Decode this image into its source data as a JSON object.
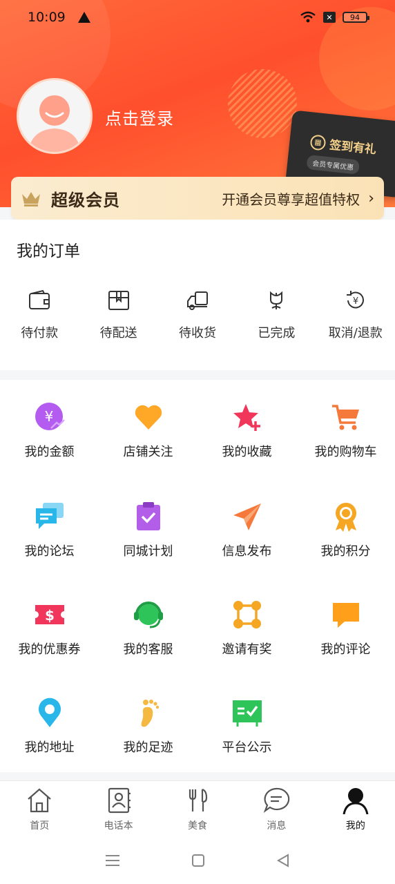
{
  "status": {
    "time": "10:09",
    "battery": "94"
  },
  "profile": {
    "login": "点击登录"
  },
  "sign_card": {
    "title": "签到有礼",
    "subtitle": "会员专属优惠"
  },
  "vip": {
    "title": "超级会员",
    "desc": "开通会员尊享超值特权"
  },
  "orders": {
    "title": "我的订单",
    "items": [
      {
        "label": "待付款",
        "icon": "wallet-icon"
      },
      {
        "label": "待配送",
        "icon": "package-icon"
      },
      {
        "label": "待收货",
        "icon": "truck-icon"
      },
      {
        "label": "已完成",
        "icon": "flower-icon"
      },
      {
        "label": "取消/退款",
        "icon": "refund-icon"
      }
    ]
  },
  "grid": {
    "items": [
      {
        "label": "我的金额",
        "icon": "yen-coin-icon",
        "color": "#b45cf0"
      },
      {
        "label": "店铺关注",
        "icon": "heart-icon",
        "color": "#ffa726"
      },
      {
        "label": "我的收藏",
        "icon": "star-add-icon",
        "color": "#f0365a"
      },
      {
        "label": "我的购物车",
        "icon": "cart-icon",
        "color": "#f4793b"
      },
      {
        "label": "我的论坛",
        "icon": "chat-bubbles-icon",
        "color": "#29b6e8"
      },
      {
        "label": "同城计划",
        "icon": "clipboard-check-icon",
        "color": "#b35ee8"
      },
      {
        "label": "信息发布",
        "icon": "paper-plane-icon",
        "color": "#f4793b"
      },
      {
        "label": "我的积分",
        "icon": "medal-icon",
        "color": "#f5a623"
      },
      {
        "label": "我的优惠券",
        "icon": "coupon-icon",
        "color": "#f0365a"
      },
      {
        "label": "我的客服",
        "icon": "headset-icon",
        "color": "#2ec45a"
      },
      {
        "label": "邀请有奖",
        "icon": "network-icon",
        "color": "#f5a623"
      },
      {
        "label": "我的评论",
        "icon": "comment-icon",
        "color": "#ff9f1a"
      },
      {
        "label": "我的地址",
        "icon": "location-pin-icon",
        "color": "#29b6e8"
      },
      {
        "label": "我的足迹",
        "icon": "footprint-icon",
        "color": "#f5b942"
      },
      {
        "label": "平台公示",
        "icon": "notice-board-icon",
        "color": "#2ec45a"
      }
    ]
  },
  "tabs": [
    {
      "label": "首页",
      "icon": "home-icon"
    },
    {
      "label": "电话本",
      "icon": "contacts-icon"
    },
    {
      "label": "美食",
      "icon": "food-icon"
    },
    {
      "label": "消息",
      "icon": "message-icon"
    },
    {
      "label": "我的",
      "icon": "user-icon",
      "active": true
    }
  ]
}
